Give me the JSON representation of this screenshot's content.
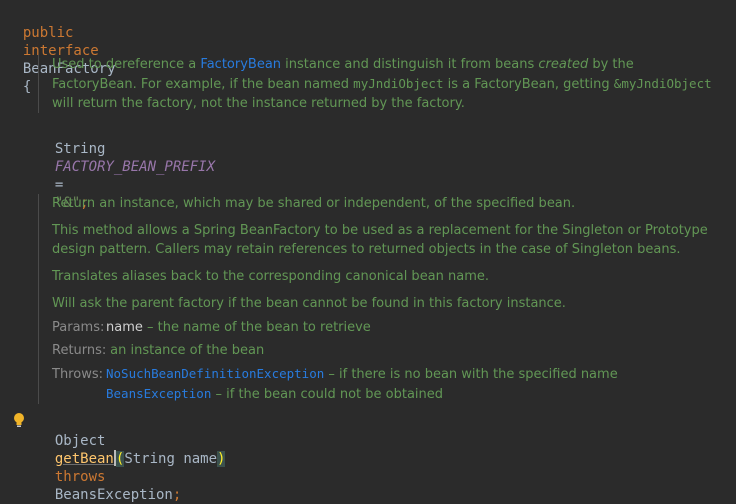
{
  "code": {
    "line1": {
      "kw_public": "public",
      "kw_interface": "interface",
      "name": "BeanFactory",
      "brace": "{"
    },
    "line2": {
      "type": "String",
      "const": "FACTORY_BEAN_PREFIX",
      "eq": "=",
      "value": "\"&\"",
      "semi": ";"
    },
    "line3": {
      "type": "Object",
      "method": "getBean",
      "paren_open": "(",
      "param_type": "String",
      "param_name": "name",
      "paren_close": ")",
      "kw_throws": "throws",
      "exception": "BeansException",
      "semi": ";"
    }
  },
  "doc1": {
    "l1_a": "Used to dereference a ",
    "l1_link": "FactoryBean",
    "l1_b": " instance and distinguish it from beans ",
    "l1_em": "created",
    "l1_c": " by the",
    "l2_a": "FactoryBean. For example, if the bean named ",
    "l2_code1": "myJndiObject",
    "l2_b": " is a FactoryBean, getting ",
    "l2_code2": "&myJndiObject",
    "l3": "will return the factory, not the instance returned by the factory."
  },
  "doc2": {
    "p1": "Return an instance, which may be shared or independent, of the specified bean.",
    "p2_l1": "This method allows a Spring BeanFactory to be used as a replacement for the Singleton or Prototype",
    "p2_l2": "design pattern. Callers may retain references to returned objects in the case of Singleton beans.",
    "p3": "Translates aliases back to the corresponding canonical bean name.",
    "p4": "Will ask the parent factory if the bean cannot be found in this factory instance.",
    "params_label": "Params:",
    "params_name": "name",
    "params_desc": " – the name of the bean to retrieve",
    "returns_label": "Returns:",
    "returns_desc": " an instance of the bean",
    "throws_label": "Throws:",
    "throws1_link": "NoSuchBeanDefinitionException",
    "throws1_desc": " – if there is no bean with the specified name",
    "throws2_link": "BeansException",
    "throws2_desc": " – if the bean could not be obtained"
  },
  "icons": {
    "bulb": "lightbulb-icon"
  },
  "colors": {
    "background": "#2b2b2b",
    "keyword": "#cc7832",
    "doc_text": "#629755",
    "link": "#287bde",
    "method": "#ffc66d",
    "constant": "#9876aa",
    "string": "#6a8759"
  }
}
